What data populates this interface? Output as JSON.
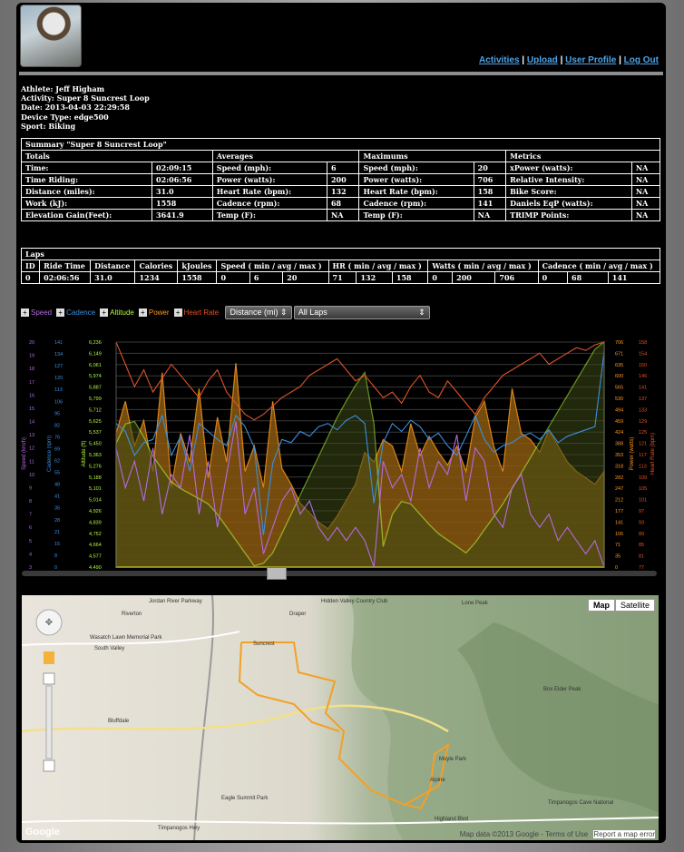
{
  "nav": {
    "activities": "Activities",
    "upload": "Upload",
    "profile": "User Profile",
    "logout": "Log Out",
    "sep": "|"
  },
  "meta": {
    "athlete": "Athlete: Jeff Higham",
    "activity": "Activity: Super 8 Suncrest Loop",
    "date": "Date: 2013-04-03 22:29:58",
    "device": "Device Type: edge500",
    "sport": "Sport: Biking"
  },
  "summary": {
    "title": "Summary \"Super 8 Suncrest Loop\"",
    "headers": [
      "Totals",
      "Averages",
      "Maximums",
      "Metrics"
    ],
    "rows": [
      [
        "Time:",
        "02:09:15",
        "Speed (mph):",
        "6",
        "Speed (mph):",
        "20",
        "xPower (watts):",
        "NA"
      ],
      [
        "Time Riding:",
        "02:06:56",
        "Power (watts):",
        "200",
        "Power (watts):",
        "706",
        "Relative Intensity:",
        "NA"
      ],
      [
        "Distance (miles):",
        "31.0",
        "Heart Rate (bpm):",
        "132",
        "Heart Rate (bpm):",
        "158",
        "Bike Score:",
        "NA"
      ],
      [
        "Work (kJ):",
        "1558",
        "Cadence (rpm):",
        "68",
        "Cadence (rpm):",
        "141",
        "Daniels EqP (watts):",
        "NA"
      ],
      [
        "Elevation Gain(Feet):",
        "3641.9",
        "Temp (F):",
        "NA",
        "Temp (F):",
        "NA",
        "TRIMP Points:",
        "NA"
      ]
    ]
  },
  "laps": {
    "title": "Laps",
    "headers": [
      "ID",
      "Ride Time",
      "Distance",
      "Calories",
      "kJoules",
      "Speed ( min / avg / max )",
      "HR ( min / avg / max )",
      "Watts ( min / avg / max )",
      "Cadence ( min / avg / max )"
    ],
    "row": [
      "0",
      "02:06:56",
      "31.0",
      "1234",
      "1558",
      "0",
      "6",
      "20",
      "71",
      "132",
      "158",
      "0",
      "200",
      "706",
      "0",
      "68",
      "141"
    ]
  },
  "controls": {
    "legend": [
      {
        "label": "Speed",
        "color": "#b36ae2"
      },
      {
        "label": "Cadence",
        "color": "#3b8fe0"
      },
      {
        "label": "Altitude",
        "color": "#b7ff3c"
      },
      {
        "label": "Power",
        "color": "#ff9a1f"
      },
      {
        "label": "Heart Rate",
        "color": "#e0532a"
      }
    ],
    "x_axis_select": "Distance (mi)",
    "lap_select": "All Laps"
  },
  "chart_data": {
    "type": "line",
    "y_axes": [
      {
        "label": "Speed (km/h)",
        "color": "#b36ae2",
        "ticks": [
          "3",
          "4",
          "5",
          "6",
          "7",
          "8",
          "9",
          "10",
          "11",
          "12",
          "13",
          "14",
          "15",
          "16",
          "17",
          "18",
          "19",
          "20"
        ]
      },
      {
        "label": "Cadence (rpm)",
        "color": "#3b8fe0",
        "ticks": [
          "0",
          "8",
          "15",
          "21",
          "28",
          "35",
          "41",
          "48",
          "55",
          "62",
          "69",
          "76",
          "82",
          "95",
          "106",
          "113",
          "120",
          "127",
          "134",
          "141"
        ]
      },
      {
        "label": "Altitude (ft)",
        "color": "#b7ff3c",
        "ticks": [
          "4,490",
          "4,577",
          "4,664",
          "4,752",
          "4,839",
          "4,926",
          "5,014",
          "5,101",
          "5,188",
          "5,276",
          "5,363",
          "5,450",
          "5,537",
          "5,625",
          "5,712",
          "5,799",
          "5,887",
          "5,974",
          "6,061",
          "6,149",
          "6,236"
        ]
      },
      {
        "label": "Power (watts)",
        "color": "#ff9a1f",
        "ticks": [
          "0",
          "35",
          "71",
          "106",
          "141",
          "177",
          "212",
          "247",
          "282",
          "318",
          "353",
          "388",
          "424",
          "459",
          "494",
          "530",
          "565",
          "600",
          "635",
          "671",
          "706"
        ]
      },
      {
        "label": "Heart Rate (bpm)",
        "color": "#e0532a",
        "ticks": [
          "77",
          "81",
          "85",
          "89",
          "93",
          "97",
          "101",
          "105",
          "109",
          "113",
          "117",
          "121",
          "125",
          "129",
          "133",
          "137",
          "141",
          "146",
          "150",
          "154",
          "158"
        ]
      }
    ],
    "altitude_profile": [
      5450,
      5600,
      5620,
      5500,
      5350,
      5250,
      5150,
      5100,
      5060,
      5020,
      4980,
      4900,
      4800,
      4700,
      4600,
      4500,
      4520,
      4600,
      4750,
      4900,
      5050,
      5200,
      5350,
      5500,
      5650,
      5780,
      5900,
      6000,
      5600,
      4650,
      4900,
      5000,
      4980,
      4900,
      4820,
      4750,
      4700,
      4650,
      4600,
      4680,
      4780,
      4880,
      4980,
      5100,
      5220,
      5340,
      5460,
      5580,
      5700,
      5820,
      5940,
      6060,
      6180,
      6236
    ],
    "power_profile": [
      420,
      520,
      380,
      460,
      300,
      610,
      250,
      420,
      330,
      560,
      280,
      470,
      330,
      640,
      300,
      380,
      250,
      520,
      310,
      260,
      200,
      170,
      140,
      120,
      160,
      210,
      260,
      360,
      330,
      400,
      380,
      300,
      450,
      350,
      410,
      360,
      320,
      380,
      300,
      470,
      520,
      380,
      300,
      560,
      420,
      400,
      360,
      430,
      380,
      330,
      300,
      280,
      260,
      300
    ],
    "cadence_profile": [
      90,
      85,
      70,
      78,
      80,
      95,
      70,
      82,
      60,
      90,
      85,
      80,
      76,
      95,
      88,
      75,
      20,
      65,
      80,
      78,
      85,
      82,
      88,
      90,
      86,
      92,
      95,
      90,
      40,
      78,
      90,
      85,
      92,
      88,
      80,
      84,
      76,
      70,
      82,
      95,
      80,
      72,
      76,
      78,
      82,
      84,
      80,
      86,
      78,
      82,
      84,
      86,
      88,
      135
    ],
    "speed_profile": [
      12,
      9,
      11,
      8,
      12,
      7,
      10,
      9,
      13,
      7,
      11,
      6,
      10,
      14,
      7,
      9,
      4,
      6,
      8,
      9,
      7,
      8,
      6,
      5,
      6,
      5,
      6,
      5,
      3,
      11,
      9,
      10,
      8,
      12,
      9,
      11,
      10,
      13,
      8,
      12,
      11,
      7,
      6,
      9,
      10,
      7,
      6,
      7,
      5,
      6,
      5,
      4,
      5,
      3
    ],
    "hr_profile": [
      158,
      150,
      142,
      148,
      140,
      145,
      150,
      146,
      142,
      138,
      144,
      148,
      140,
      136,
      132,
      130,
      132,
      135,
      138,
      140,
      142,
      146,
      148,
      150,
      152,
      148,
      144,
      146,
      142,
      138,
      140,
      136,
      142,
      146,
      140,
      138,
      144,
      140,
      136,
      132,
      138,
      142,
      146,
      148,
      150,
      152,
      154,
      150,
      152,
      154,
      156,
      155,
      157,
      158
    ]
  },
  "map": {
    "type_map": "Map",
    "type_satellite": "Satellite",
    "attribution": "Map data ©2013 Google - Terms of Use",
    "report": "Report a map error",
    "google": "Google",
    "labels": [
      "Jordan River Parkway",
      "Riverton",
      "Draper",
      "Hidden Valley Country Club",
      "Wasatch Lawn Memorial Park",
      "South Valley",
      "Bluffdale",
      "Suncrest",
      "Box Elder Peak",
      "Alpine",
      "Moyle Park",
      "Eagle Summit Park",
      "Timpanogos Cave National",
      "Lone Peak",
      "Highland Blvd",
      "Timpanogos Hwy"
    ]
  }
}
